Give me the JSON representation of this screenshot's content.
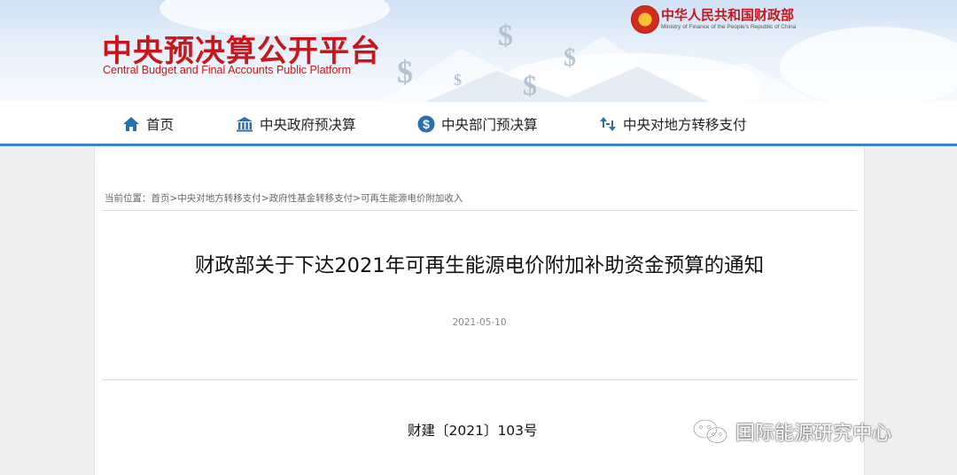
{
  "header": {
    "site_title": "中央预决算公开平台",
    "site_subtitle": "Central Budget and Final Accounts Public Platform",
    "ministry_cn": "中华人民共和国财政部",
    "ministry_en": "Ministry of Finance of the People's Republic of China",
    "brand_color": "#c8161d"
  },
  "nav": {
    "items": [
      {
        "label": "首页",
        "icon": "home-icon"
      },
      {
        "label": "中央政府预决算",
        "icon": "government-building-icon"
      },
      {
        "label": "中央部门预决算",
        "icon": "dollar-circle-icon"
      },
      {
        "label": "中央对地方转移支付",
        "icon": "transfer-arrows-icon"
      }
    ],
    "accent_color": "#3a83c4"
  },
  "breadcrumb": {
    "prefix": "当前位置：",
    "items": [
      "首页",
      "中央对地方转移支付",
      "政府性基金转移支付",
      "可再生能源电价附加收入"
    ],
    "separator": ">"
  },
  "article": {
    "title": "财政部关于下达2021年可再生能源电价附加补助资金预算的通知",
    "date": "2021-05-10",
    "doc_number": "财建〔2021〕103号"
  },
  "watermark": {
    "text": "国际能源研究中心",
    "icon": "wechat-icon"
  }
}
